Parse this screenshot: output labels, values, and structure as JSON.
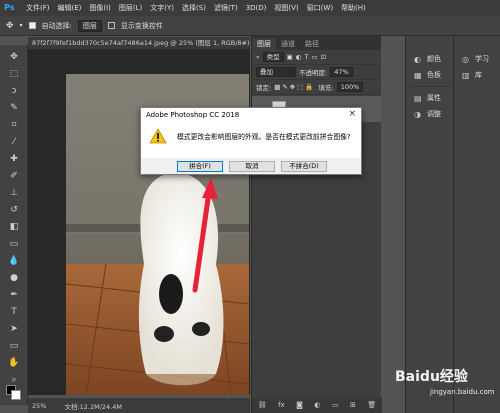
{
  "menu": {
    "logo": "Ps",
    "items": [
      "文件(F)",
      "编辑(E)",
      "图像(I)",
      "图层(L)",
      "文字(Y)",
      "选择(S)",
      "滤镜(T)",
      "3D(D)",
      "视图(V)",
      "窗口(W)",
      "帮助(H)"
    ]
  },
  "options": {
    "auto_select_label": "自动选择:",
    "auto_select_value": "图层",
    "show_transform_label": "显示变换控件"
  },
  "document": {
    "tab_title": "87f2f7f9fef1bdd370c5e74af7486a14.jpeg @ 25% (图层 1, RGB/8#) *",
    "zoom": "25%",
    "doc_info": "文档:12.2M/24.4M"
  },
  "layers_panel": {
    "tabs": [
      "图层",
      "通道",
      "路径"
    ],
    "kind_label": "类型",
    "blend_mode": "叠加",
    "opacity_label": "不透明度:",
    "opacity_value": "47%",
    "lock_label": "锁定:",
    "fill_label": "填充:",
    "fill_value": "100%"
  },
  "right_panels": {
    "col1": [
      "颜色",
      "色板",
      "属性",
      "调整"
    ],
    "col2": [
      "学习",
      "库"
    ]
  },
  "dialog": {
    "title": "Adobe Photoshop CC 2018",
    "message": "模式更改会影响图层的外观。是否在模式更改前拼合图像?",
    "buttons": [
      "拼合(F)",
      "取消",
      "不拼合(D)"
    ]
  },
  "watermark": {
    "text": "Baidu经验",
    "sub": "jingyan.baidu.com"
  },
  "colors": {
    "ui_dark": "#535353",
    "accent": "#31a8ff",
    "arrow": "#e8203a"
  }
}
